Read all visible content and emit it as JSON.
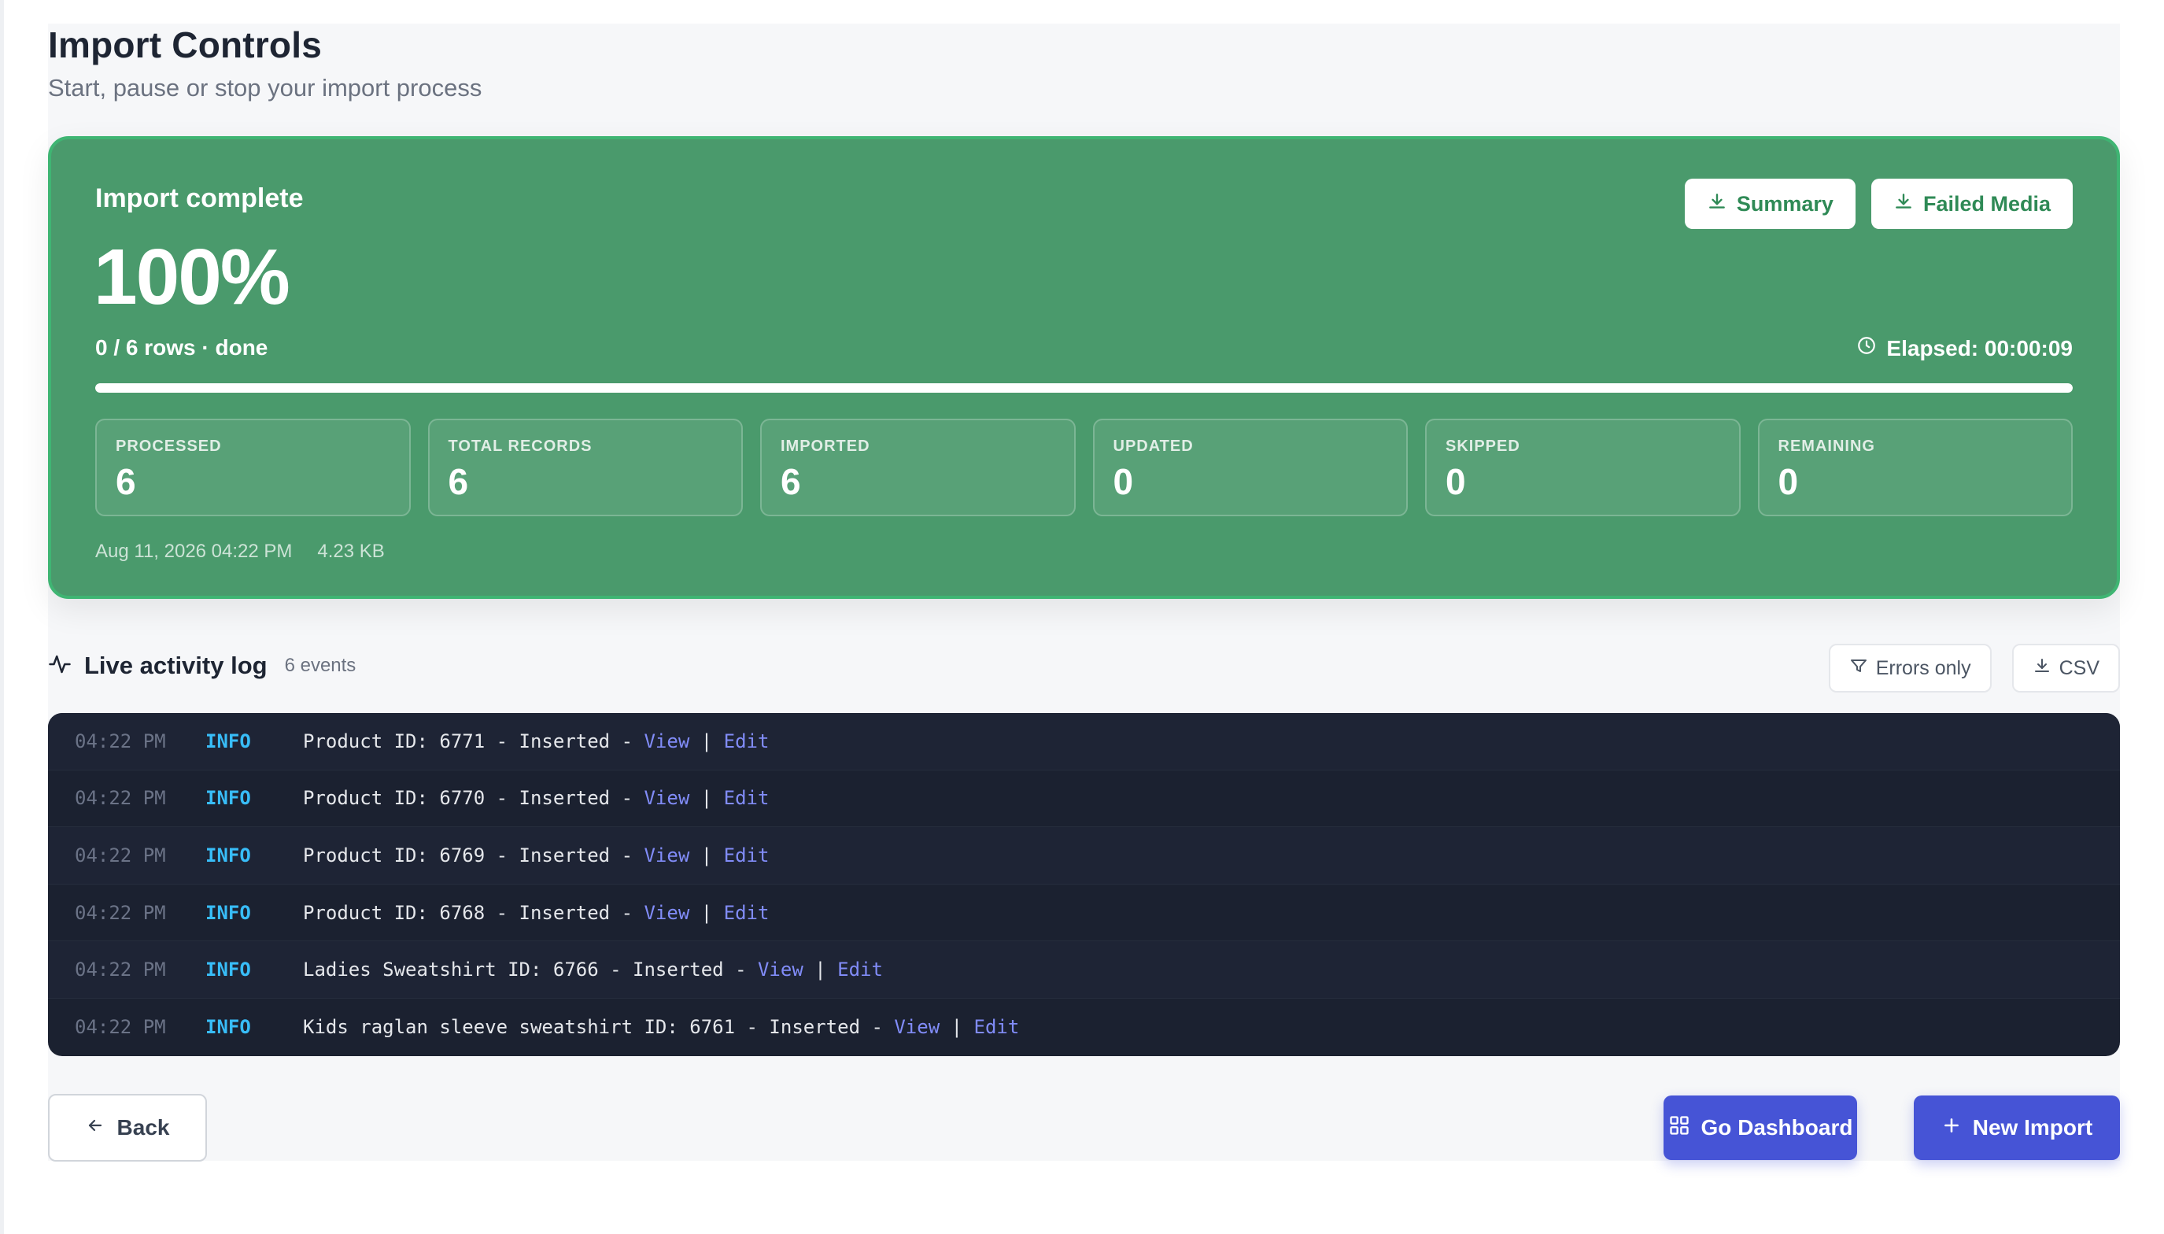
{
  "page": {
    "title": "Import Controls",
    "subtitle": "Start, pause or stop your import process"
  },
  "hero": {
    "status": "Import complete",
    "percent": "100%",
    "progress_fraction": 1.0,
    "rows": "0 / 6 rows · done",
    "elapsed": "Elapsed: 00:00:09",
    "buttons": {
      "summary": "Summary",
      "failed_media": "Failed Media"
    },
    "stats": [
      {
        "label": "PROCESSED",
        "value": "6"
      },
      {
        "label": "TOTAL RECORDS",
        "value": "6"
      },
      {
        "label": "IMPORTED",
        "value": "6"
      },
      {
        "label": "UPDATED",
        "value": "0"
      },
      {
        "label": "SKIPPED",
        "value": "0"
      },
      {
        "label": "REMAINING",
        "value": "0"
      }
    ],
    "date": "Aug 11, 2026 04:22 PM",
    "size": "4.23 KB"
  },
  "log": {
    "title": "Live activity log",
    "count": "6 events",
    "tools": {
      "errors_only": "Errors only",
      "csv": "CSV"
    },
    "entries": [
      {
        "time": "04:22 PM",
        "level": "INFO",
        "message": "Product ID: 6771 - Inserted - ",
        "view": "View",
        "sep": " | ",
        "edit": "Edit"
      },
      {
        "time": "04:22 PM",
        "level": "INFO",
        "message": "Product ID: 6770 - Inserted - ",
        "view": "View",
        "sep": " | ",
        "edit": "Edit"
      },
      {
        "time": "04:22 PM",
        "level": "INFO",
        "message": "Product ID: 6769 - Inserted - ",
        "view": "View",
        "sep": " | ",
        "edit": "Edit"
      },
      {
        "time": "04:22 PM",
        "level": "INFO",
        "message": "Product ID: 6768 - Inserted - ",
        "view": "View",
        "sep": " | ",
        "edit": "Edit"
      },
      {
        "time": "04:22 PM",
        "level": "INFO",
        "message": "Ladies Sweatshirt ID: 6766 - Inserted - ",
        "view": "View",
        "sep": " | ",
        "edit": "Edit"
      },
      {
        "time": "04:22 PM",
        "level": "INFO",
        "message": "Kids raglan sleeve sweatshirt ID: 6761 - Inserted - ",
        "view": "View",
        "sep": " | ",
        "edit": "Edit"
      }
    ]
  },
  "footer": {
    "back": "Back",
    "dashboard": "Go Dashboard",
    "new_import": "New Import"
  },
  "colors": {
    "hero_bg": "#4a9a6c",
    "hero_border": "#3fb573",
    "log_bg": "#1b2130",
    "primary": "#4654d6",
    "link": "#818cf8",
    "info": "#38bdf8"
  },
  "icons": {
    "summary": "download-icon",
    "failed_media": "download-icon",
    "elapsed": "clock-icon",
    "log": "activity-icon",
    "errors_only": "filter-icon",
    "csv": "download-icon",
    "back": "arrow-left-icon",
    "dashboard": "grid-icon",
    "new_import": "plus-icon"
  }
}
